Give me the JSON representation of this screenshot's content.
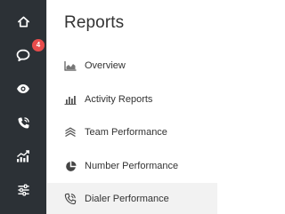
{
  "colors": {
    "rail_bg": "#2c3136",
    "rail_icon": "#ffffff",
    "badge_bg": "#e84c4c",
    "panel_bg": "#ffffff",
    "active_row_bg": "#f2f2f2",
    "text": "#333333"
  },
  "rail": {
    "items": [
      {
        "icon": "home-icon"
      },
      {
        "icon": "chat-icon",
        "badge": "4"
      },
      {
        "icon": "eye-icon"
      },
      {
        "icon": "phone-icon"
      },
      {
        "icon": "trend-chart-icon"
      },
      {
        "icon": "sliders-icon"
      }
    ]
  },
  "panel": {
    "title": "Reports",
    "items": [
      {
        "label": "Overview",
        "icon": "area-chart-icon"
      },
      {
        "label": "Activity Reports",
        "icon": "bar-chart-icon"
      },
      {
        "label": "Team Performance",
        "icon": "layers-icon"
      },
      {
        "label": "Number Performance",
        "icon": "pie-chart-icon"
      },
      {
        "label": "Dialer Performance",
        "icon": "phone-outgoing-icon",
        "active": true
      }
    ]
  }
}
